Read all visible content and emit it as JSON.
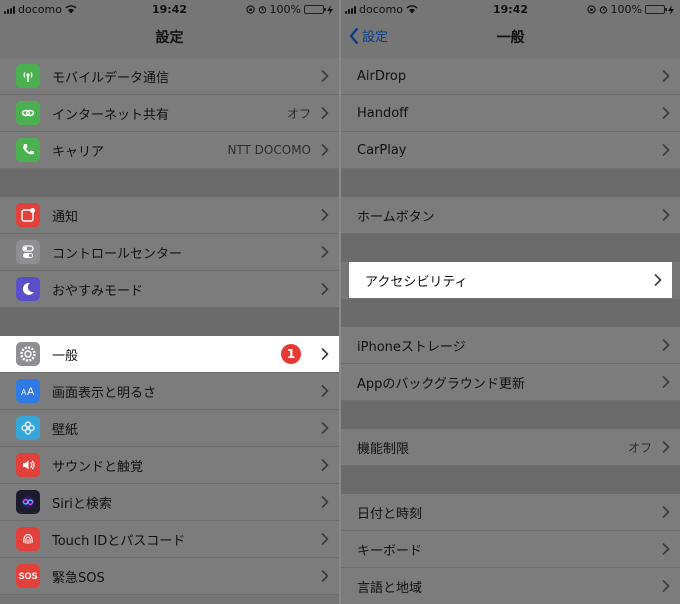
{
  "status": {
    "carrier": "docomo",
    "time": "19:42",
    "battery": "100%"
  },
  "left": {
    "title": "設定",
    "groups": [
      [
        {
          "label": "モバイルデータ通信",
          "value": "",
          "icon": "antenna-icon",
          "color": "#4bb04f"
        },
        {
          "label": "インターネット共有",
          "value": "オフ",
          "icon": "chain-icon",
          "color": "#4bb04f"
        },
        {
          "label": "キャリア",
          "value": "NTT DOCOMO",
          "icon": "phone-icon",
          "color": "#4bb04f"
        }
      ],
      [
        {
          "label": "通知",
          "value": "",
          "icon": "notification-icon",
          "color": "#e2403a"
        },
        {
          "label": "コントロールセンター",
          "value": "",
          "icon": "toggle-icon",
          "color": "#8e8e93"
        },
        {
          "label": "おやすみモード",
          "value": "",
          "icon": "moon-icon",
          "color": "#5b4fc9"
        }
      ],
      [
        {
          "label": "一般",
          "value": "",
          "icon": "gear-icon",
          "color": "#8e8e93",
          "badge": "1"
        },
        {
          "label": "画面表示と明るさ",
          "value": "",
          "icon": "text-size-icon",
          "color": "#2f7ae5"
        },
        {
          "label": "壁紙",
          "value": "",
          "icon": "flower-icon",
          "color": "#35a6d8"
        },
        {
          "label": "サウンドと触覚",
          "value": "",
          "icon": "speaker-icon",
          "color": "#e2403a"
        },
        {
          "label": "Siriと検索",
          "value": "",
          "icon": "siri-icon",
          "color": "#1c1c2e"
        },
        {
          "label": "Touch IDとパスコード",
          "value": "",
          "icon": "fingerprint-icon",
          "color": "#e2403a"
        },
        {
          "label": "緊急SOS",
          "value": "",
          "icon": "sos-icon",
          "color": "#e2403a",
          "text": "SOS"
        }
      ]
    ]
  },
  "right": {
    "back_label": "設定",
    "title": "一般",
    "groups": [
      [
        {
          "label": "AirDrop",
          "value": ""
        },
        {
          "label": "Handoff",
          "value": ""
        },
        {
          "label": "CarPlay",
          "value": ""
        }
      ],
      [
        {
          "label": "ホームボタン",
          "value": ""
        }
      ],
      [
        {
          "label": "アクセシビリティ",
          "value": ""
        }
      ],
      [
        {
          "label": "iPhoneストレージ",
          "value": ""
        },
        {
          "label": "Appのバックグラウンド更新",
          "value": ""
        }
      ],
      [
        {
          "label": "機能制限",
          "value": "オフ"
        }
      ],
      [
        {
          "label": "日付と時刻",
          "value": ""
        },
        {
          "label": "キーボード",
          "value": ""
        },
        {
          "label": "言語と地域",
          "value": ""
        }
      ]
    ]
  }
}
